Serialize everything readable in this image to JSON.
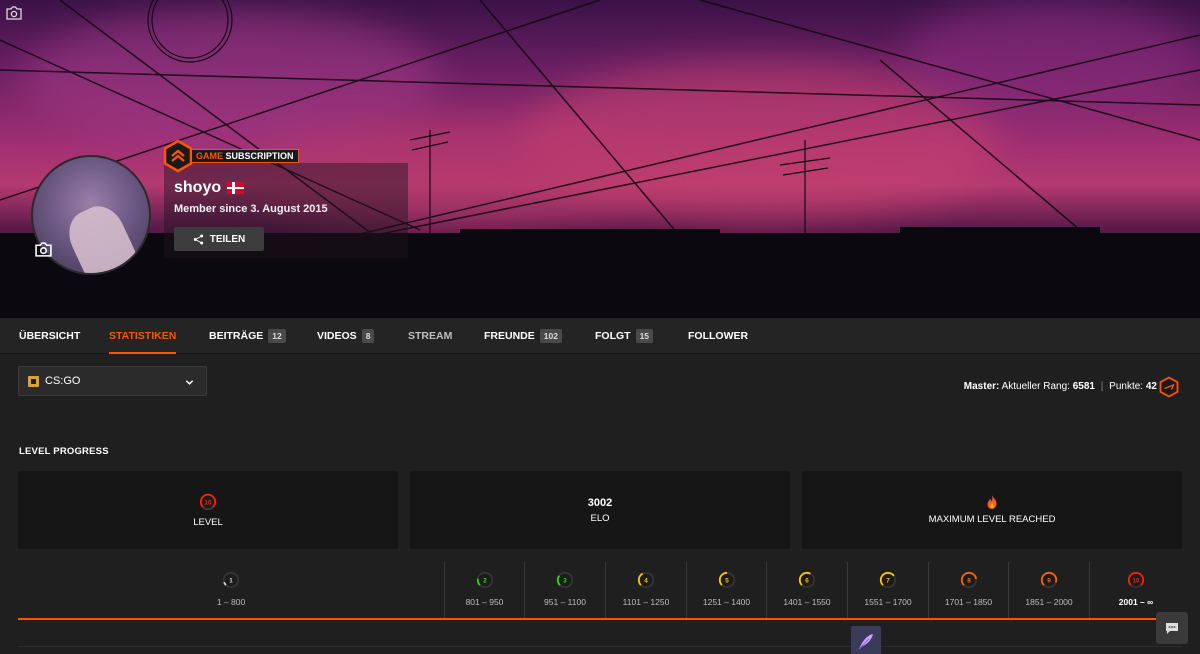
{
  "profile": {
    "badge_game": "GAME",
    "badge_subscription": "SUBSCRIPTION",
    "username": "shoyo",
    "member_since": "Member since 3. August 2015",
    "share_label": "TEILEN"
  },
  "tabs": [
    {
      "label": "ÜBERSICHT",
      "count": null
    },
    {
      "label": "STATISTIKEN",
      "count": null
    },
    {
      "label": "BEITRÄGE",
      "count": "12"
    },
    {
      "label": "VIDEOS",
      "count": "8"
    },
    {
      "label": "STREAM",
      "count": null
    },
    {
      "label": "FREUNDE",
      "count": "102"
    },
    {
      "label": "FOLGT",
      "count": "15"
    },
    {
      "label": "FOLLOWER",
      "count": null
    }
  ],
  "game_select": {
    "value": "CS:GO"
  },
  "master": {
    "label": "Master:",
    "rank_label": "Aktueller Rang:",
    "rank": "6581",
    "separator": "|",
    "points_label": "Punkte:",
    "points": "42"
  },
  "level_progress": {
    "title": "LEVEL PROGRESS",
    "level_value": "10",
    "level_label": "LEVEL",
    "elo_value": "3002",
    "elo_label": "ELO",
    "max_label": "MAXIMUM LEVEL REACHED",
    "levels": [
      {
        "level": "1",
        "range": "1 – 800",
        "color": "#d8d8d8"
      },
      {
        "level": "2",
        "range": "801 – 950",
        "color": "#1ce400"
      },
      {
        "level": "3",
        "range": "951 – 1100",
        "color": "#1ce400"
      },
      {
        "level": "4",
        "range": "1101 – 1250",
        "color": "#ffc800"
      },
      {
        "level": "5",
        "range": "1251 – 1400",
        "color": "#ffc800"
      },
      {
        "level": "6",
        "range": "1401 – 1550",
        "color": "#ffc800"
      },
      {
        "level": "7",
        "range": "1551 – 1700",
        "color": "#ffc800"
      },
      {
        "level": "8",
        "range": "1701 – 1850",
        "color": "#ff6309"
      },
      {
        "level": "9",
        "range": "1851 – 2000",
        "color": "#ff6309"
      },
      {
        "level": "10",
        "range": "2001 – ∞",
        "color": "#fe1f00"
      }
    ]
  },
  "colors": {
    "accent": "#ff5500",
    "background": "#1f1f1f",
    "card": "#161616"
  }
}
